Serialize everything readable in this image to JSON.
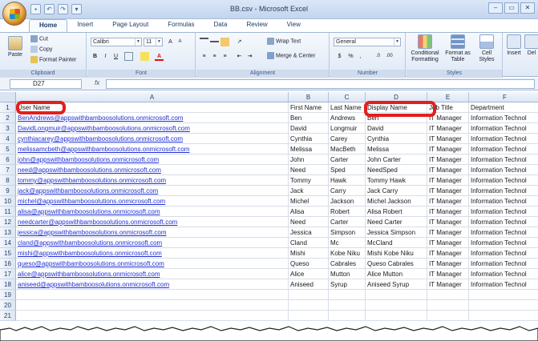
{
  "window": {
    "title": "BB.csv - Microsoft Excel",
    "controls": [
      "–",
      "▭",
      "✕"
    ]
  },
  "quick_access": [
    "save-icon",
    "undo-icon",
    "redo-icon",
    "customize-icon"
  ],
  "tabs": [
    "Home",
    "Insert",
    "Page Layout",
    "Formulas",
    "Data",
    "Review",
    "View"
  ],
  "ribbon": {
    "clipboard": {
      "label": "Clipboard",
      "paste": "Paste",
      "cut": "Cut",
      "copy": "Copy",
      "format_painter": "Format Painter"
    },
    "font": {
      "label": "Font",
      "name": "Calibri",
      "size": "11"
    },
    "alignment": {
      "label": "Alignment",
      "wrap_text": "Wrap Text",
      "merge_center": "Merge & Center"
    },
    "number": {
      "label": "Number",
      "format": "General",
      "currency": "$",
      "percent": "%",
      "comma": ","
    },
    "styles": {
      "label": "Styles",
      "conditional": "Conditional Formatting",
      "format_table": "Format as Table",
      "cell_styles": "Cell Styles"
    },
    "cells": {
      "insert": "Insert",
      "delete": "Del"
    }
  },
  "formula_bar": {
    "name_box": "D27",
    "fx": "fx",
    "value": ""
  },
  "columns": [
    "A",
    "B",
    "C",
    "D",
    "E",
    "F"
  ],
  "rows": [
    [
      "User Name",
      "First Name",
      "Last Name",
      "Display Name",
      "Job Title",
      "Department"
    ],
    [
      "BenAndrews@appswithbamboosolutions.onmicrosoft.com",
      "Ben",
      "Andrews",
      "Ben",
      "IT Manager",
      "Information Technol"
    ],
    [
      "DavidLongmuir@appswithbamboosolutions.onmicrosoft.com",
      "David",
      "Longmuir",
      "David",
      "IT Manager",
      "Information Technol"
    ],
    [
      "cynthiacarey@appswithbamboosolutions.onmicrosoft.com",
      "Cynthia",
      "Carey",
      "Cynthia",
      "IT Manager",
      "Information Technol"
    ],
    [
      "melissamcbeth@appswithbamboosolutions.onmicrosoft.com",
      "Melissa",
      "MacBeth",
      "Melissa",
      "IT Manager",
      "Information Technol"
    ],
    [
      "john@appswithbamboosolutions.onmicrosoft.com",
      "John",
      "Carter",
      "John Carter",
      "IT Manager",
      "Information Technol"
    ],
    [
      "need@appswithbamboosolutions.onmicrosoft.com",
      "Need",
      "Sped",
      "NeedSped",
      "IT Manager",
      "Information Technol"
    ],
    [
      "tommy@appswithbamboosolutions.onmicrosoft.com",
      "Tommy",
      "Hawk",
      "Tommy Hawk",
      "IT Manager",
      "Information Technol"
    ],
    [
      "jack@appswithbamboosolutions.onmicrosoft.com",
      "Jack",
      "Carry",
      "Jack Carry",
      "IT Manager",
      "Information Technol"
    ],
    [
      "michel@appswithbamboosolutions.onmicrosoft.com",
      "Michel",
      "Jackson",
      "Michel Jackson",
      "IT Manager",
      "Information Technol"
    ],
    [
      "alisa@appswithbamboosolutions.onmicrosoft.com",
      "Alisa",
      "Robert",
      "Alisa Robert",
      "IT Manager",
      "Information Technol"
    ],
    [
      "needcarter@appswithbamboosolutions.onmicrosoft.com",
      "Need",
      "Carter",
      "Need Carter",
      "IT Manager",
      "Information Technol"
    ],
    [
      "jessica@appswithbamboosolutions.onmicrosoft.com",
      "Jessica",
      "Simpson",
      "Jessica Simpson",
      "IT Manager",
      "Information Technol"
    ],
    [
      "cland@appswithbamboosolutions.onmicrosoft.com",
      "Cland",
      "Mc",
      "McCland",
      "IT Manager",
      "Information Technol"
    ],
    [
      "mishi@appswithbamboosolutions.onmicrosoft.com",
      "Mishi",
      "Kobe Niku",
      "Mishi Kobe Niku",
      "IT Manager",
      "Information Technol"
    ],
    [
      "queso@appswithbamboosolutions.onmicrosoft.com",
      "Queso",
      "Cabrales",
      "Queso Cabrales",
      "IT Manager",
      "Information Technol"
    ],
    [
      "alice@appswithbamboosolutions.onmicrosoft.com",
      "Alice",
      "Mutton",
      "Alice Mutton",
      "IT Manager",
      "Information Technol"
    ],
    [
      "aniseed@appswithbamboosolutions.onmicrosoft.com",
      "Aniseed",
      "Syrup",
      "Aniseed Syrup",
      "IT Manager",
      "Information Technol"
    ],
    [
      "",
      "",
      "",
      "",
      "",
      ""
    ],
    [
      "",
      "",
      "",
      "",
      "",
      ""
    ],
    [
      "",
      "",
      "",
      "",
      "",
      ""
    ]
  ],
  "colors": {
    "highlight": "#e41e1e",
    "link": "#1f2fd4"
  }
}
